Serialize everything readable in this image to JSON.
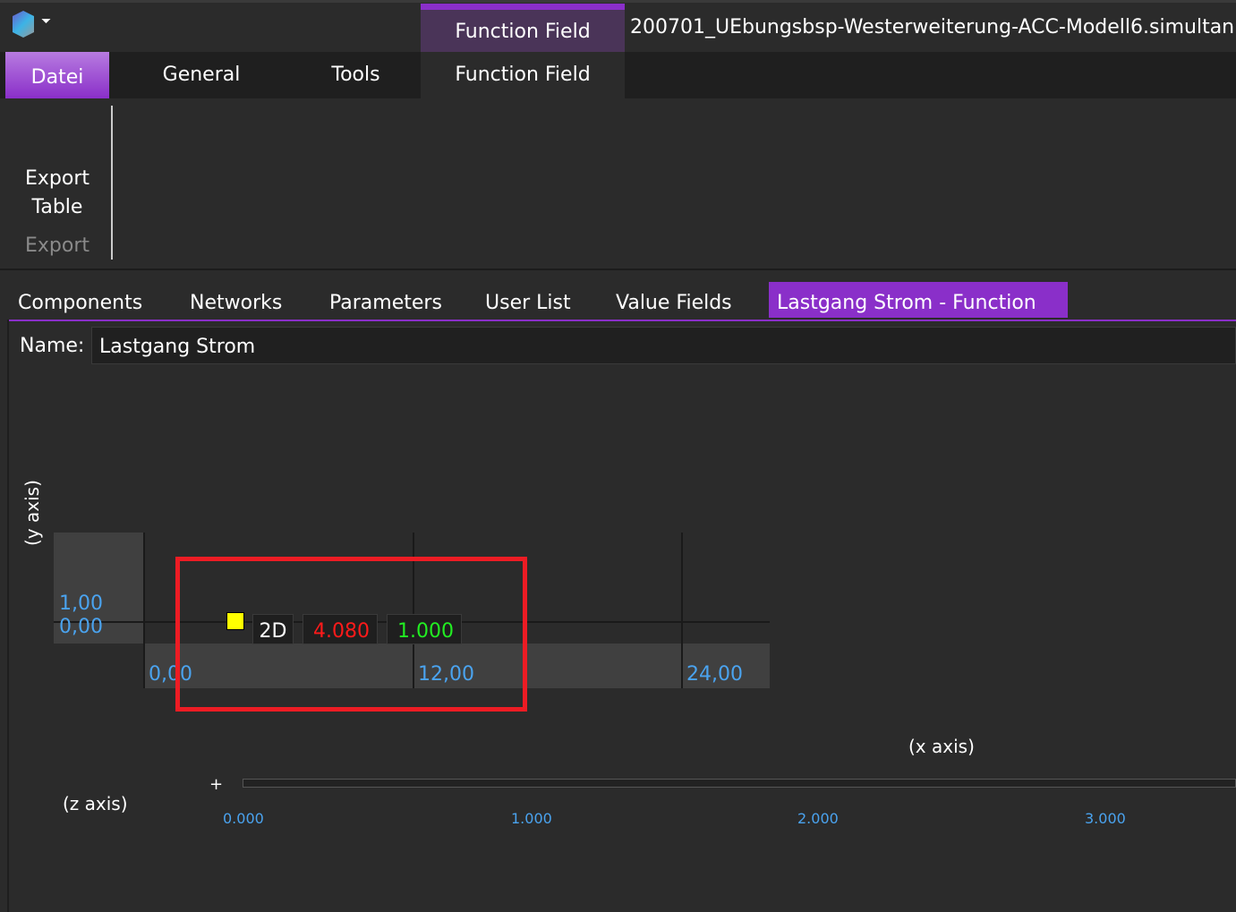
{
  "window": {
    "title": "200701_UEbungsbsp-Westerweiterung-ACC-Modell6.simultan -",
    "context_tab": "Function Field"
  },
  "ribbon": {
    "tabs": [
      "Datei",
      "General",
      "Tools",
      "Function Field"
    ],
    "buttons": [
      {
        "label_line1": "Export",
        "label_line2": "Table"
      }
    ],
    "group_label": "Export"
  },
  "doc_tabs": [
    "Components",
    "Networks",
    "Parameters",
    "User List",
    "Value Fields",
    "Lastgang Strom - Function"
  ],
  "name_field": {
    "label": "Name:",
    "value": "Lastgang Strom"
  },
  "chart": {
    "y_label": "(y axis)",
    "x_label": "(x axis)",
    "z_label": "(z axis)",
    "y_ticks": [
      "1,00",
      "0,00"
    ],
    "x_ticks": [
      "0,00",
      "12,00",
      "24,00"
    ],
    "mode": "2D",
    "value_red": "4.080",
    "value_green": "1.000",
    "z_plus": "+",
    "z_ticks": [
      "0.000",
      "1.000",
      "2.000",
      "3.000"
    ]
  },
  "colors": {
    "accent": "#8a2fc9",
    "highlight": "#ed1c24"
  }
}
